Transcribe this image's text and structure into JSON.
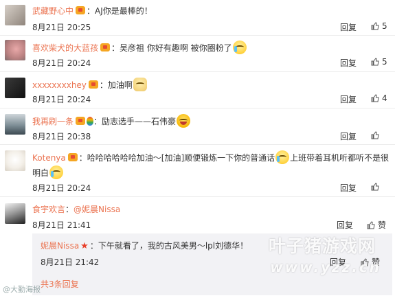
{
  "comments": [
    {
      "username": "武藏野心中",
      "separator": "：",
      "text": "AJ你是最棒的！",
      "time": "8月21日 20:25",
      "reply_label": "回复",
      "likes": "5"
    },
    {
      "username": "喜欢柴犬的大蓝孩",
      "separator": "：",
      "text": "吴彦祖 你好有趣啊 被你圈粉了",
      "time": "8月21日 20:24",
      "reply_label": "回复",
      "likes": "5"
    },
    {
      "username": "xxxxxxxxhey",
      "separator": "：",
      "text": "加油啊",
      "time": "8月21日 20:24",
      "reply_label": "回复",
      "likes": "4"
    },
    {
      "username": "我再刷一条",
      "separator": "：",
      "text": "励志选手——石伟豪",
      "time": "8月21日 20:38",
      "reply_label": "回复",
      "likes": ""
    },
    {
      "username": "Kotenya",
      "separator": "：",
      "text": "哈哈哈哈哈哈加油～[加油]顺便锻炼一下你的普通话",
      "text2": "上班带着耳机听都听不是很",
      "text3": "明白",
      "time": "8月21日 20:24",
      "reply_label": "回复",
      "likes": ""
    },
    {
      "username": "食宇欢言",
      "separator": "：",
      "text": "@妮晨Nissa",
      "time": "8月21日 21:41",
      "reply_label": "回复",
      "likes": ""
    }
  ],
  "nested_reply": {
    "username": "妮晨Nissa",
    "separator": "：",
    "text": "下午就看了，我的古风美男～lpl刘德华！",
    "time": "8月21日 21:42",
    "reply_label": "回复",
    "like_label": "赞",
    "more_replies": "共3条回复"
  },
  "watermarks": {
    "site_name": "叶子猪游戏网",
    "site_url": "www.yzz.cn",
    "bottom_left": "@大勤海报"
  },
  "colors": {
    "username": "#eb7350",
    "text": "#333333",
    "nested_bg": "#f2f2f5"
  }
}
